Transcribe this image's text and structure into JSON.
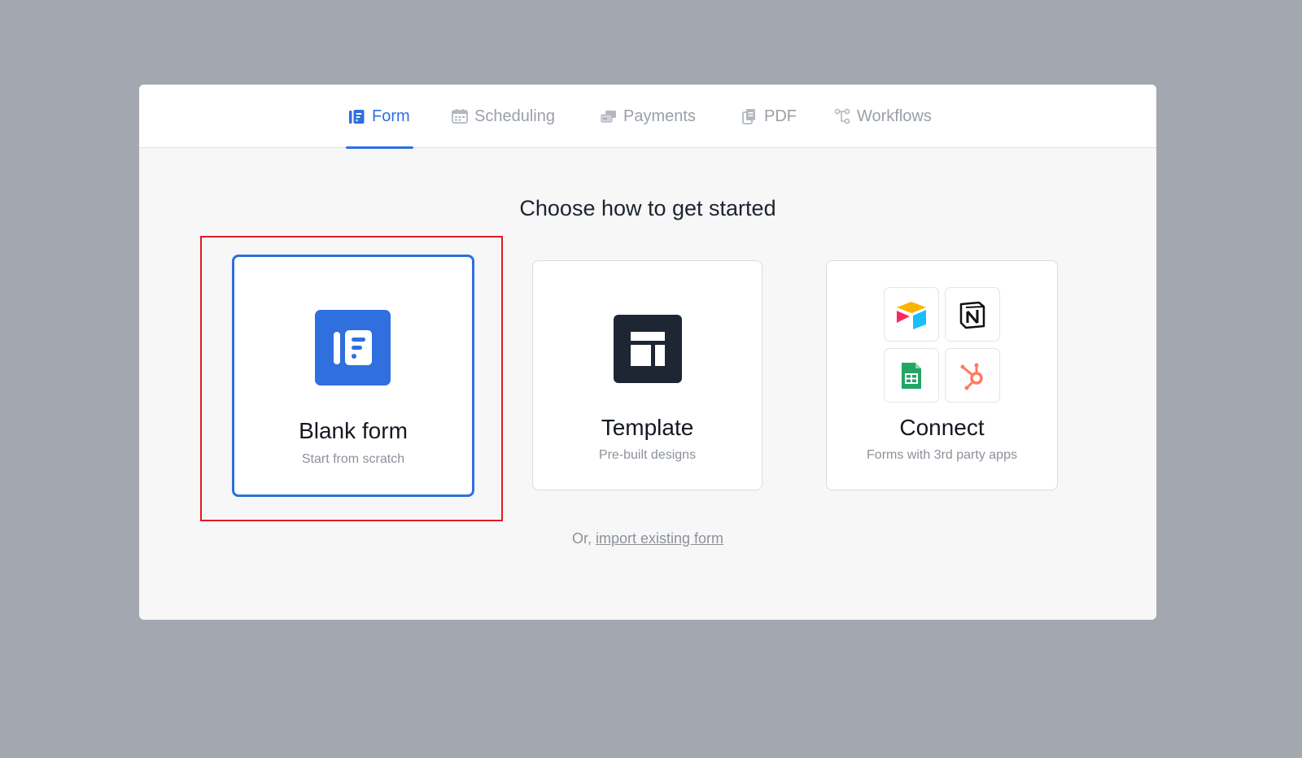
{
  "tabs": [
    {
      "id": "form",
      "label": "Form",
      "icon": "form-icon",
      "active": true
    },
    {
      "id": "scheduling",
      "label": "Scheduling",
      "icon": "calendar-icon",
      "active": false
    },
    {
      "id": "payments",
      "label": "Payments",
      "icon": "payments-icon",
      "active": false
    },
    {
      "id": "pdf",
      "label": "PDF",
      "icon": "pdf-icon",
      "active": false
    },
    {
      "id": "workflows",
      "label": "Workflows",
      "icon": "workflows-icon",
      "active": false
    }
  ],
  "heading": "Choose how to get started",
  "options": {
    "blank": {
      "title": "Blank form",
      "subtitle": "Start from scratch",
      "selected": true
    },
    "template": {
      "title": "Template",
      "subtitle": "Pre-built designs"
    },
    "connect": {
      "title": "Connect",
      "subtitle": "Forms with 3rd party apps",
      "apps": [
        "airtable-logo",
        "notion-logo",
        "google-sheets-logo",
        "hubspot-logo"
      ]
    }
  },
  "import": {
    "prefix": "Or, ",
    "link": "import existing form"
  },
  "colors": {
    "accent": "#2f6fde",
    "highlight": "#e01b24",
    "backdrop": "#a3a8b0"
  }
}
